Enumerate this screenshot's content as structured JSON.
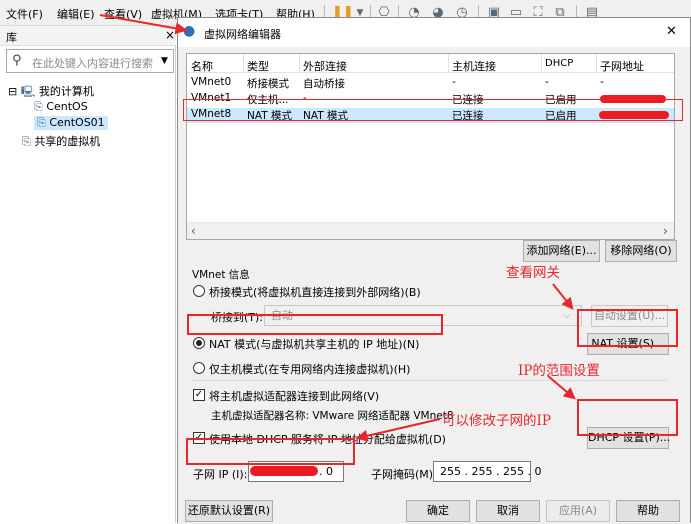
{
  "app": {
    "menu": [
      "文件(F)",
      "编辑(E)",
      "查看(V)",
      "虚拟机(M)",
      "选项卡(T)",
      "帮助(H)"
    ],
    "library": {
      "title": "库",
      "close_glyph": "×",
      "search_placeholder": "在此处键入内容进行搜索",
      "tree": [
        {
          "label": "我的计算机",
          "expander": "⊟"
        },
        {
          "label": "CentOS"
        },
        {
          "label": "CentOS01",
          "selected": true
        },
        {
          "label": "共享的虚拟机"
        }
      ]
    }
  },
  "dialog": {
    "title": "虚拟网络编辑器",
    "close_glyph": "✕",
    "table": {
      "columns": [
        "名称",
        "类型",
        "外部连接",
        "主机连接",
        "DHCP",
        "子网地址"
      ],
      "rows": [
        {
          "name": "VMnet0",
          "type": "桥接模式",
          "external": "自动桥接",
          "host": "-",
          "dhcp": "-",
          "subnet": "-"
        },
        {
          "name": "VMnet1",
          "type": "仅主机...",
          "external": "-",
          "host": "已连接",
          "dhcp": "已启用",
          "subnet": ""
        },
        {
          "name": "VMnet8",
          "type": "NAT 模式",
          "external": "NAT 模式",
          "host": "已连接",
          "dhcp": "已启用",
          "subnet": ""
        }
      ]
    },
    "add_network_label": "添加网络(E)...",
    "remove_network_label": "移除网络(O)",
    "vmnet_info_label": "VMnet 信息",
    "bridge_mode_label": "桥接模式(将虚拟机直接连接到外部网络)(B)",
    "bridge_to_label": "桥接到(T):",
    "bridge_to_value": "自动",
    "auto_settings_label": "自动设置(U)...",
    "nat_mode_label": "NAT 模式(与虚拟机共享主机的 IP 地址)(N)",
    "nat_settings_label": "NAT 设置(S)...",
    "host_only_label": "仅主机模式(在专用网络内连接虚拟机)(H)",
    "connect_adapter_label": "将主机虚拟适配器连接到此网络(V)",
    "adapter_name_label": "主机虚拟适配器名称: VMware 网络适配器 VMnet8",
    "use_dhcp_label": "使用本地 DHCP 服务将 IP 地址分配给虚拟机(D)",
    "dhcp_settings_label": "DHCP 设置(P)...",
    "subnet_ip_label": "子网 IP (I):",
    "subnet_ip_value": ". 0",
    "subnet_mask_label": "子网掩码(M):",
    "subnet_mask_value": "255 . 255 . 255 . 0",
    "restore_defaults_label": "还原默认设置(R)",
    "ok_label": "确定",
    "cancel_label": "取消",
    "apply_label": "应用(A)",
    "help_label": "帮助"
  },
  "annotations": {
    "check_gateway": "查看网关",
    "ip_range_settings": "IP的范围设置",
    "change_subnet_ip": "可以修改子网的IP"
  },
  "colors": {
    "annotation": "#e8262b",
    "selection": "#cce8ff"
  }
}
